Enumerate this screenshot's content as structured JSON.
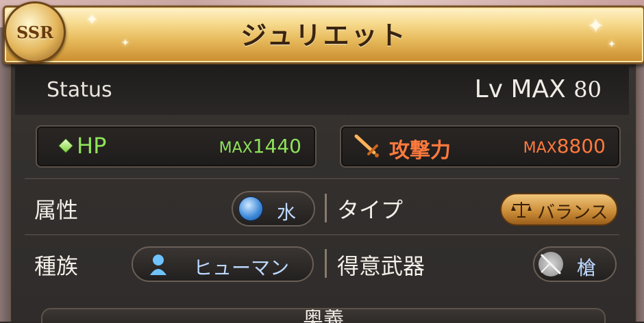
{
  "character": {
    "rarity": "SSR",
    "name": "ジュリエット"
  },
  "status": {
    "label": "Status",
    "level_prefix": "Lv MAX",
    "level_value": "80"
  },
  "stats": {
    "hp_label": "HP",
    "hp_max_prefix": "MAX",
    "hp_max_value": "1440",
    "atk_label": "攻撃力",
    "atk_max_prefix": "MAX",
    "atk_max_value": "8800"
  },
  "info": {
    "element_label": "属性",
    "element_value": "水",
    "type_label": "タイプ",
    "type_value": "バランス",
    "race_label": "種族",
    "race_value": "ヒューマン",
    "weapon_label": "得意武器",
    "weapon_value": "槍"
  },
  "footer": {
    "section_title": "奥義"
  },
  "colors": {
    "hp_green": "#8fe25a",
    "atk_orange": "#ff7a3d",
    "banner_gold": "#e6b95a",
    "element_water": "#3a86d8"
  },
  "icons": {
    "rarity_badge": "ssr-badge-icon",
    "hp": "diamond-icon",
    "attack": "sword-icon",
    "element": "water-drop-icon",
    "type": "balance-scale-icon",
    "race": "human-silhouette-icon",
    "weapon": "spear-icon"
  }
}
